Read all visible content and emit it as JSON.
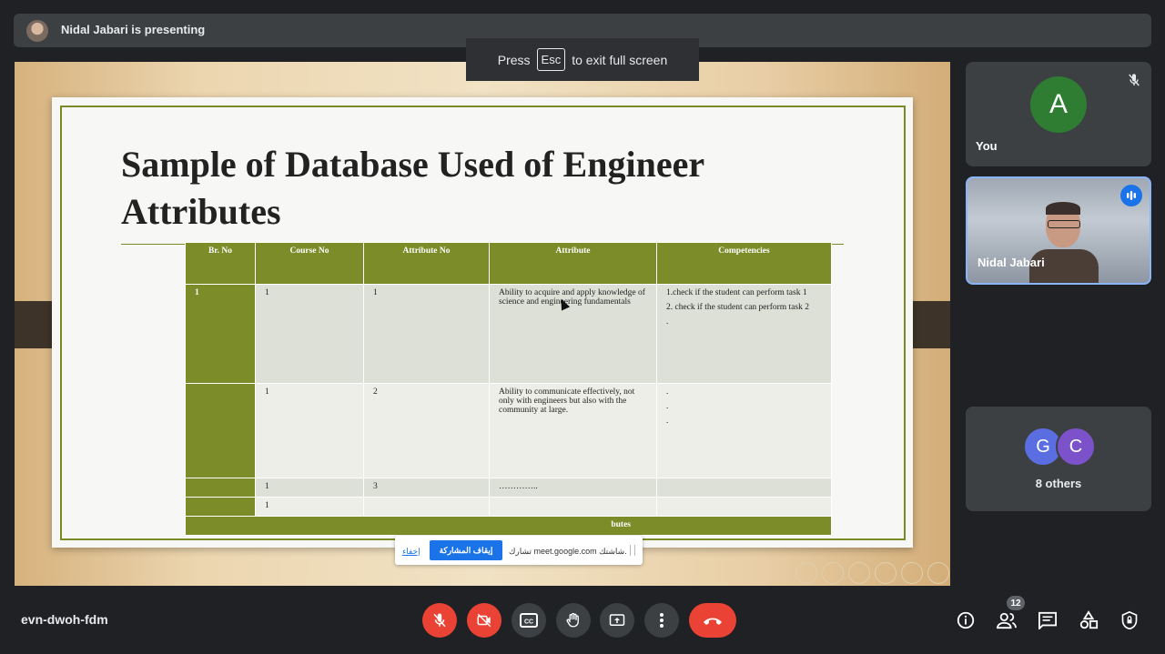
{
  "topbar": {
    "presenter_text": "Nidal Jabari is presenting"
  },
  "fullscreen_hint": {
    "before": "Press",
    "key": "Esc",
    "after": "to exit full screen"
  },
  "slide": {
    "title": "Sample of Database Used of Engineer Attributes",
    "table": {
      "headers": [
        "Br. No",
        "Course No",
        "Attribute No",
        "Attribute",
        "Competencies"
      ],
      "rows": [
        {
          "br": "1",
          "course": "1",
          "attr_no": "1",
          "attribute": "Ability to acquire and apply knowledge of science and engineering fundamentals",
          "competencies": [
            "1.check if the student can perform task 1",
            "2. check if the student can perform task 2",
            "."
          ]
        },
        {
          "br": "",
          "course": "1",
          "attr_no": "2",
          "attribute": "Ability to communicate effectively, not only with engineers but also with the community at large.",
          "competencies": [
            ".",
            ".",
            "."
          ]
        },
        {
          "br": "",
          "course": "1",
          "attr_no": "3",
          "attribute": "…………..",
          "competencies": []
        },
        {
          "br": "",
          "course": "1",
          "attr_no": "",
          "attribute": "",
          "competencies": []
        }
      ],
      "footer": "butes"
    }
  },
  "share_banner": {
    "hide_label": "إخفاء",
    "stop_label": "إيقاف المشاركة",
    "message": "تشارك meet.google.com شاشتك."
  },
  "participants": {
    "you": {
      "initial": "A",
      "name": "You",
      "avatar_color": "#2e7d32"
    },
    "presenter": {
      "name": "Nidal Jabari"
    },
    "others": {
      "initials": [
        "G",
        "C"
      ],
      "label": "8 others"
    }
  },
  "bottom_bar": {
    "meeting_code": "evn-dwoh-fdm",
    "participant_count": "12",
    "cc_label": "CC"
  },
  "colors": {
    "accent_red": "#ea4335",
    "slide_green": "#7c8c28",
    "accent_blue": "#1a73e8"
  }
}
